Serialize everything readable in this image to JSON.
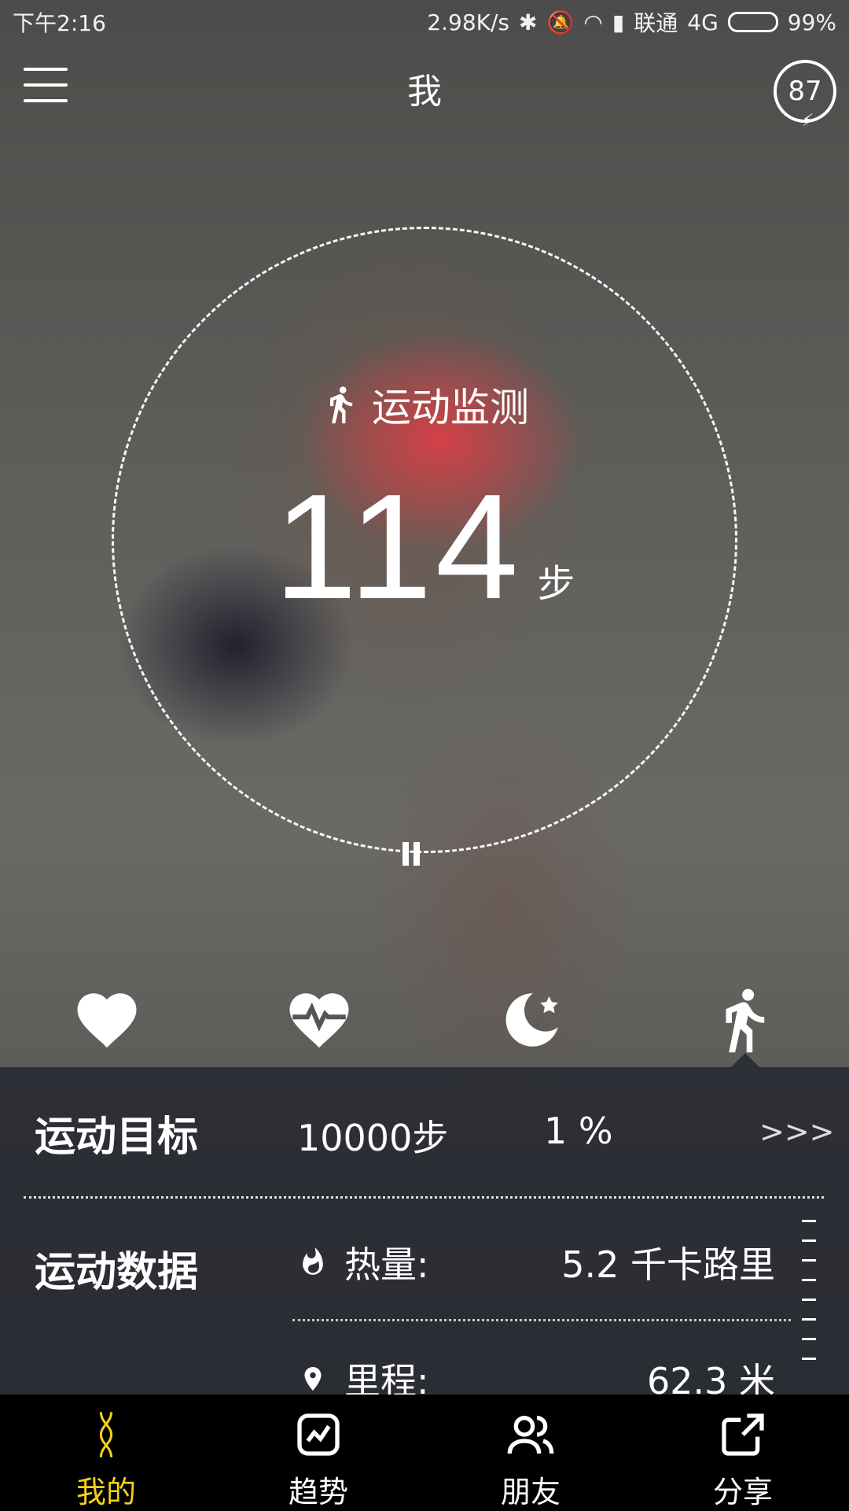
{
  "status_bar": {
    "time": "下午2:16",
    "network_speed": "2.98K/s",
    "carrier": "联通",
    "network_type": "4G",
    "battery_percent": "99%"
  },
  "header": {
    "title": "我",
    "badge_value": "87",
    "menu_icon": "hamburger-menu-icon"
  },
  "monitor": {
    "label": "运动监测",
    "steps": "114",
    "unit": "步",
    "icon": "runner-icon",
    "control_icon": "pause-icon"
  },
  "features": [
    {
      "icon": "heart-icon"
    },
    {
      "icon": "heart-rate-icon"
    },
    {
      "icon": "moon-star-icon"
    },
    {
      "icon": "runner-icon",
      "selected": true
    }
  ],
  "goal": {
    "title": "运动目标",
    "value": "10000步",
    "percent": "1 %",
    "more": ">>>"
  },
  "data_section": {
    "title": "运动数据",
    "calories": {
      "label": "热量:",
      "value": "5.2 千卡路里",
      "icon": "flame-icon"
    },
    "distance": {
      "label": "里程:",
      "value": "62.3 米",
      "icon": "location-pin-icon"
    }
  },
  "bottom_nav": [
    {
      "label": "我的",
      "icon": "dna-icon",
      "active": true
    },
    {
      "label": "趋势",
      "icon": "trend-chart-icon"
    },
    {
      "label": "朋友",
      "icon": "friends-icon"
    },
    {
      "label": "分享",
      "icon": "share-icon"
    }
  ],
  "colors": {
    "accent": "#f2d21a",
    "panel": "#282a32"
  }
}
